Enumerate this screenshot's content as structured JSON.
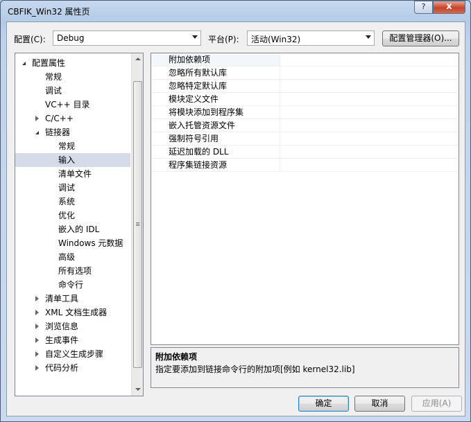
{
  "window": {
    "title": "CBFIK_Win32 属性页",
    "help_label": "?",
    "close_label": "x"
  },
  "config": {
    "label": "配置(C):",
    "value": "Debug"
  },
  "platform": {
    "label": "平台(P):",
    "value": "活动(Win32)"
  },
  "config_manager_label": "配置管理器(O)...",
  "tree": {
    "items": [
      {
        "label": "配置属性",
        "expander": "open"
      },
      {
        "label": "常规",
        "expander": "none"
      },
      {
        "label": "调试",
        "expander": "none"
      },
      {
        "label": "VC++ 目录",
        "expander": "none"
      },
      {
        "label": "C/C++",
        "expander": "closed"
      },
      {
        "label": "链接器",
        "expander": "open"
      },
      {
        "label": "常规",
        "expander": "none"
      },
      {
        "label": "输入",
        "expander": "none",
        "selected": true
      },
      {
        "label": "清单文件",
        "expander": "none"
      },
      {
        "label": "调试",
        "expander": "none"
      },
      {
        "label": "系统",
        "expander": "none"
      },
      {
        "label": "优化",
        "expander": "none"
      },
      {
        "label": "嵌入的 IDL",
        "expander": "none"
      },
      {
        "label": "Windows 元数据",
        "expander": "none"
      },
      {
        "label": "高级",
        "expander": "none"
      },
      {
        "label": "所有选项",
        "expander": "none"
      },
      {
        "label": "命令行",
        "expander": "none"
      },
      {
        "label": "清单工具",
        "expander": "closed"
      },
      {
        "label": "XML 文档生成器",
        "expander": "closed"
      },
      {
        "label": "浏览信息",
        "expander": "closed"
      },
      {
        "label": "生成事件",
        "expander": "closed"
      },
      {
        "label": "自定义生成步骤",
        "expander": "closed"
      },
      {
        "label": "代码分析",
        "expander": "closed"
      }
    ]
  },
  "grid": {
    "rows": [
      {
        "name": "附加依赖项",
        "value": ""
      },
      {
        "name": "忽略所有默认库",
        "value": ""
      },
      {
        "name": "忽略特定默认库",
        "value": ""
      },
      {
        "name": "模块定义文件",
        "value": ""
      },
      {
        "name": "将模块添加到程序集",
        "value": ""
      },
      {
        "name": "嵌入托管资源文件",
        "value": ""
      },
      {
        "name": "强制符号引用",
        "value": ""
      },
      {
        "name": "延迟加载的 DLL",
        "value": ""
      },
      {
        "name": "程序集链接资源",
        "value": ""
      }
    ]
  },
  "description": {
    "title": "附加依赖项",
    "text": "指定要添加到链接命令行的附加项[例如 kernel32.lib]"
  },
  "buttons": {
    "ok": "确定",
    "cancel": "取消",
    "apply": "应用(A)"
  }
}
